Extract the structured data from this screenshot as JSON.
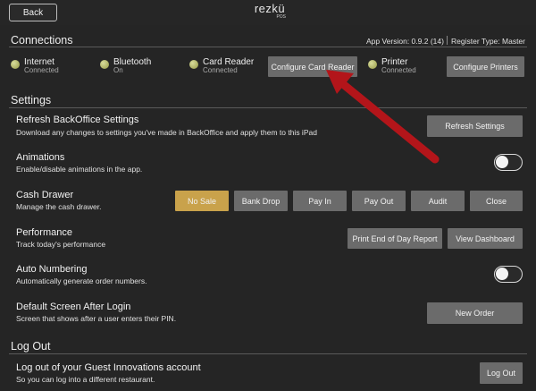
{
  "header": {
    "back_label": "Back",
    "logo_text": "rezkü",
    "logo_sub": "POS"
  },
  "connections": {
    "title": "Connections",
    "app_version": "App Version: 0.9.2 (14)",
    "register_type": "Register Type: Master",
    "items": [
      {
        "name": "Internet",
        "status": "Connected"
      },
      {
        "name": "Bluetooth",
        "status": "On"
      },
      {
        "name": "Card Reader",
        "status": "Connected"
      },
      {
        "name": "Printer",
        "status": "Connected"
      }
    ],
    "configure_card_reader": "Configure Card Reader",
    "configure_printers": "Configure Printers"
  },
  "settings": {
    "title": "Settings",
    "refresh": {
      "title": "Refresh BackOffice Settings",
      "desc": "Download any changes to settings you've made in BackOffice and apply them to this iPad",
      "button": "Refresh Settings"
    },
    "animations": {
      "title": "Animations",
      "desc": "Enable/disable animations in the app.",
      "enabled": false
    },
    "cash_drawer": {
      "title": "Cash Drawer",
      "desc": "Manage the cash drawer.",
      "buttons": [
        "No Sale",
        "Bank Drop",
        "Pay In",
        "Pay Out",
        "Audit",
        "Close"
      ]
    },
    "performance": {
      "title": "Performance",
      "desc": "Track today's performance",
      "print_button": "Print End of Day Report",
      "dashboard_button": "View Dashboard"
    },
    "auto_numbering": {
      "title": "Auto Numbering",
      "desc": "Automatically generate order numbers.",
      "enabled": false
    },
    "default_screen": {
      "title": "Default Screen After Login",
      "desc": "Screen that shows after a user enters their PIN.",
      "button": "New Order"
    }
  },
  "logout": {
    "title": "Log Out",
    "row_title": "Log out of your Guest Innovations account",
    "row_desc": "So you can log into a different restaurant.",
    "button": "Log Out"
  },
  "colors": {
    "background": "#252525",
    "button": "#6b6b6b",
    "accent_gold": "#c9a24b",
    "status_dot": "#b5ba6a",
    "annotation_arrow": "#b3151a"
  }
}
